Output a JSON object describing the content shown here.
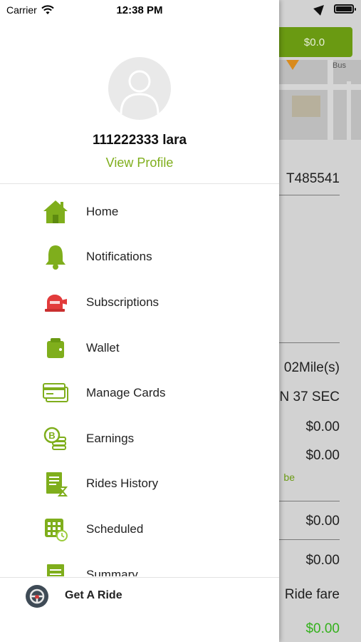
{
  "status_bar": {
    "carrier": "Carrier",
    "time": "12:38 PM"
  },
  "background": {
    "amount_button": "$0.0",
    "map_street": "Bus",
    "ride_id": "T485541",
    "distance": "02Mile(s)",
    "duration": "N 37 SEC",
    "value_1": "$0.00",
    "value_2": "$0.00",
    "note": "be",
    "value_3": "$0.00",
    "value_4": "$0.00",
    "fare_label": "Ride fare",
    "fare_value": "$0.00"
  },
  "profile": {
    "name": "111222333 lara",
    "view_profile": "View Profile"
  },
  "menu": [
    {
      "label": "Home",
      "icon": "home-icon"
    },
    {
      "label": "Notifications",
      "icon": "bell-icon"
    },
    {
      "label": "Subscriptions",
      "icon": "subscription-icon"
    },
    {
      "label": "Wallet",
      "icon": "wallet-icon"
    },
    {
      "label": "Manage Cards",
      "icon": "card-icon"
    },
    {
      "label": "Earnings",
      "icon": "coins-icon"
    },
    {
      "label": "Rides History",
      "icon": "history-icon"
    },
    {
      "label": "Scheduled",
      "icon": "calendar-icon"
    },
    {
      "label": "Summary",
      "icon": "summary-icon"
    }
  ],
  "bottom": {
    "label": "Get A Ride",
    "icon": "steering-wheel-icon"
  },
  "colors": {
    "accent": "#7fae1c",
    "subscription": "#e23b3b",
    "bg_button": "#6a9a12"
  }
}
